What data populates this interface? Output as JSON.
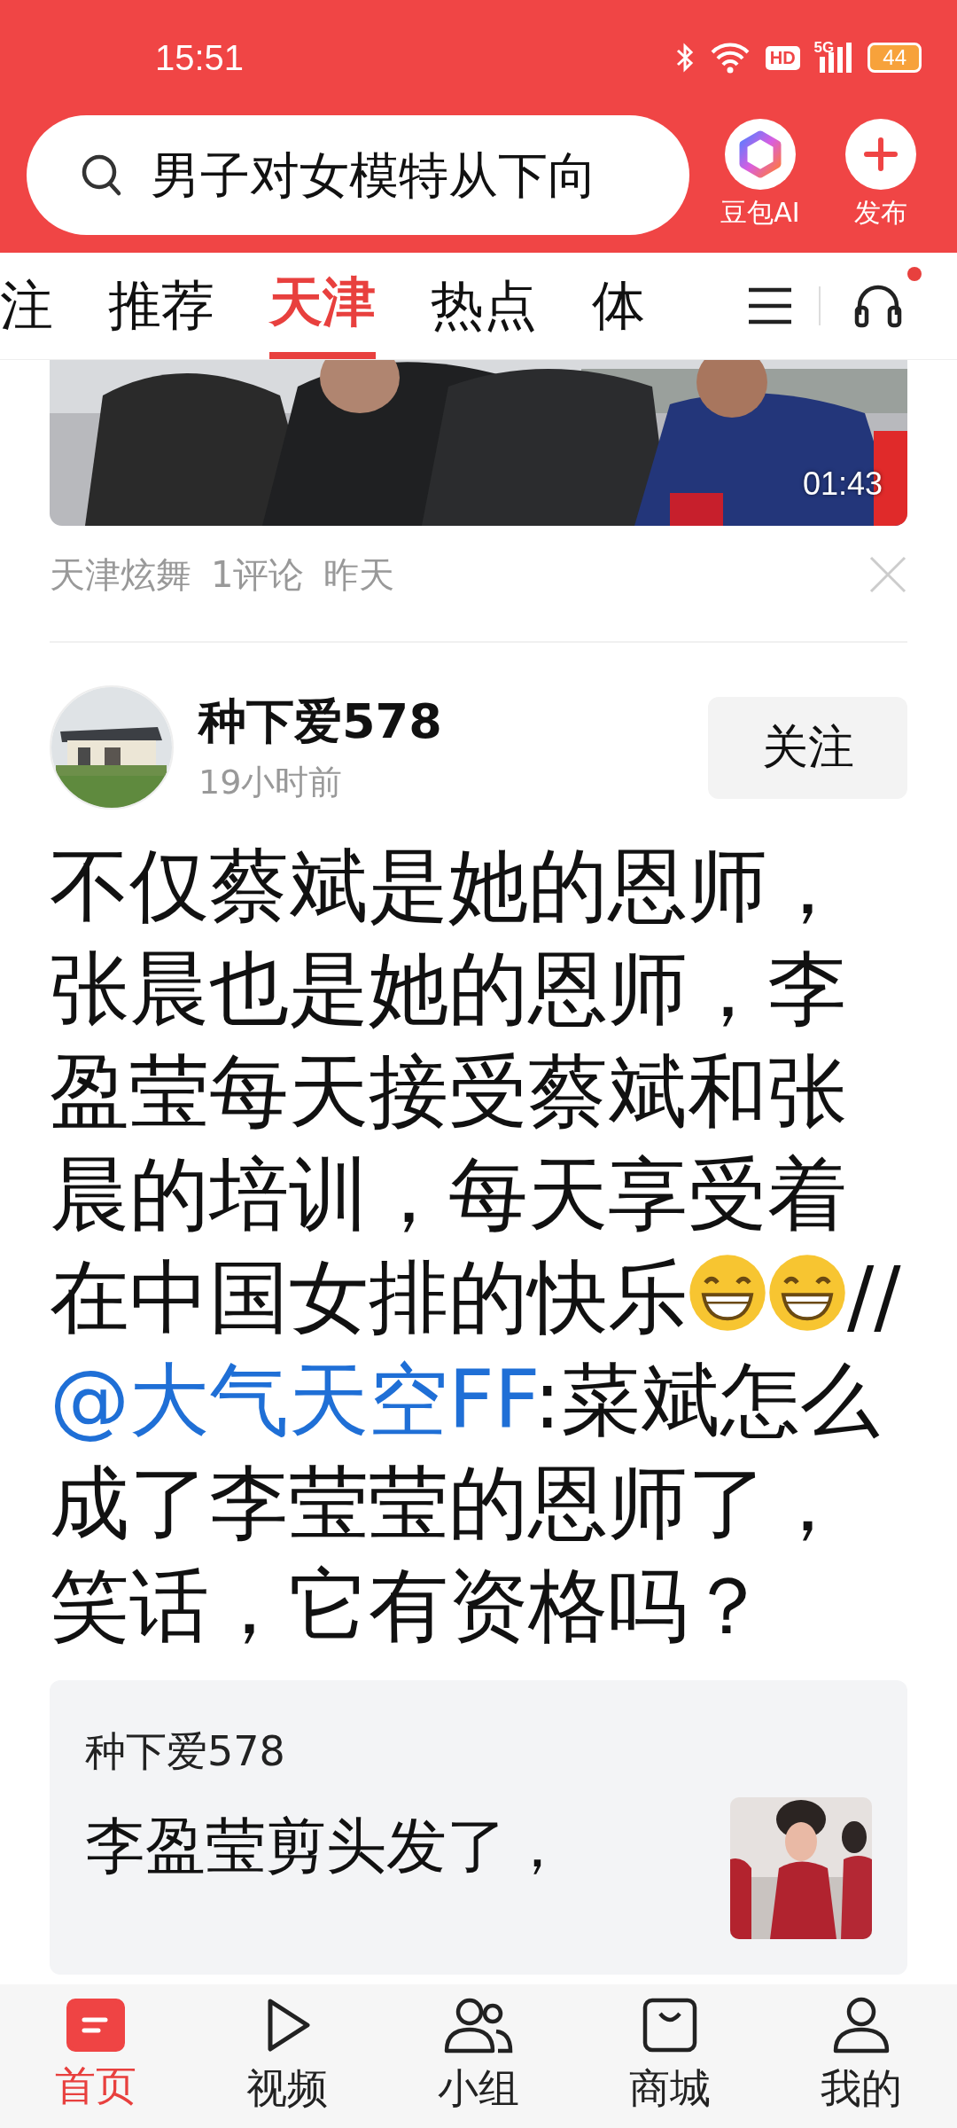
{
  "status_bar": {
    "time": "15:51",
    "hd": "HD",
    "network": "5G",
    "battery": "44"
  },
  "header": {
    "search": {
      "placeholder": "男子对女模特从下向"
    },
    "actions": [
      {
        "kind": "ai",
        "label": "豆包AI"
      },
      {
        "kind": "publish",
        "label": "发布"
      }
    ]
  },
  "tabs": [
    {
      "label": "注",
      "selected": false
    },
    {
      "label": "推荐",
      "selected": false
    },
    {
      "label": "天津",
      "selected": true
    },
    {
      "label": "热点",
      "selected": false
    },
    {
      "label": "体",
      "selected": false
    }
  ],
  "audio_badge": true,
  "video_item": {
    "duration": "01:43",
    "meta": [
      "天津炫舞",
      "1评论",
      "昨天"
    ]
  },
  "post": {
    "author": "种下爱578",
    "time": "19小时前",
    "follow": "关注",
    "body": [
      {
        "kind": "text",
        "text": "不仅蔡斌是她的恩师，张晨也是她的恩师，李盈莹每天接受蔡斌和张晨的培训，每天享受着在中国女排的快乐"
      },
      {
        "kind": "emoji"
      },
      {
        "kind": "emoji"
      },
      {
        "kind": "text",
        "text": "//"
      },
      {
        "kind": "mention",
        "text": "@大气天空FF"
      },
      {
        "kind": "text",
        "text": ":菜斌怎么成了李莹莹的恩师了，笑话，它有资格吗？"
      }
    ],
    "quote": {
      "author": "种下爱578",
      "text": "李盈莹剪头发了，"
    }
  },
  "nav": [
    {
      "kind": "home",
      "label": "首页",
      "selected": true
    },
    {
      "kind": "video",
      "label": "视频",
      "selected": false
    },
    {
      "kind": "group",
      "label": "小组",
      "selected": false
    },
    {
      "kind": "shop",
      "label": "商城",
      "selected": false
    },
    {
      "kind": "me",
      "label": "我的",
      "selected": false
    }
  ]
}
